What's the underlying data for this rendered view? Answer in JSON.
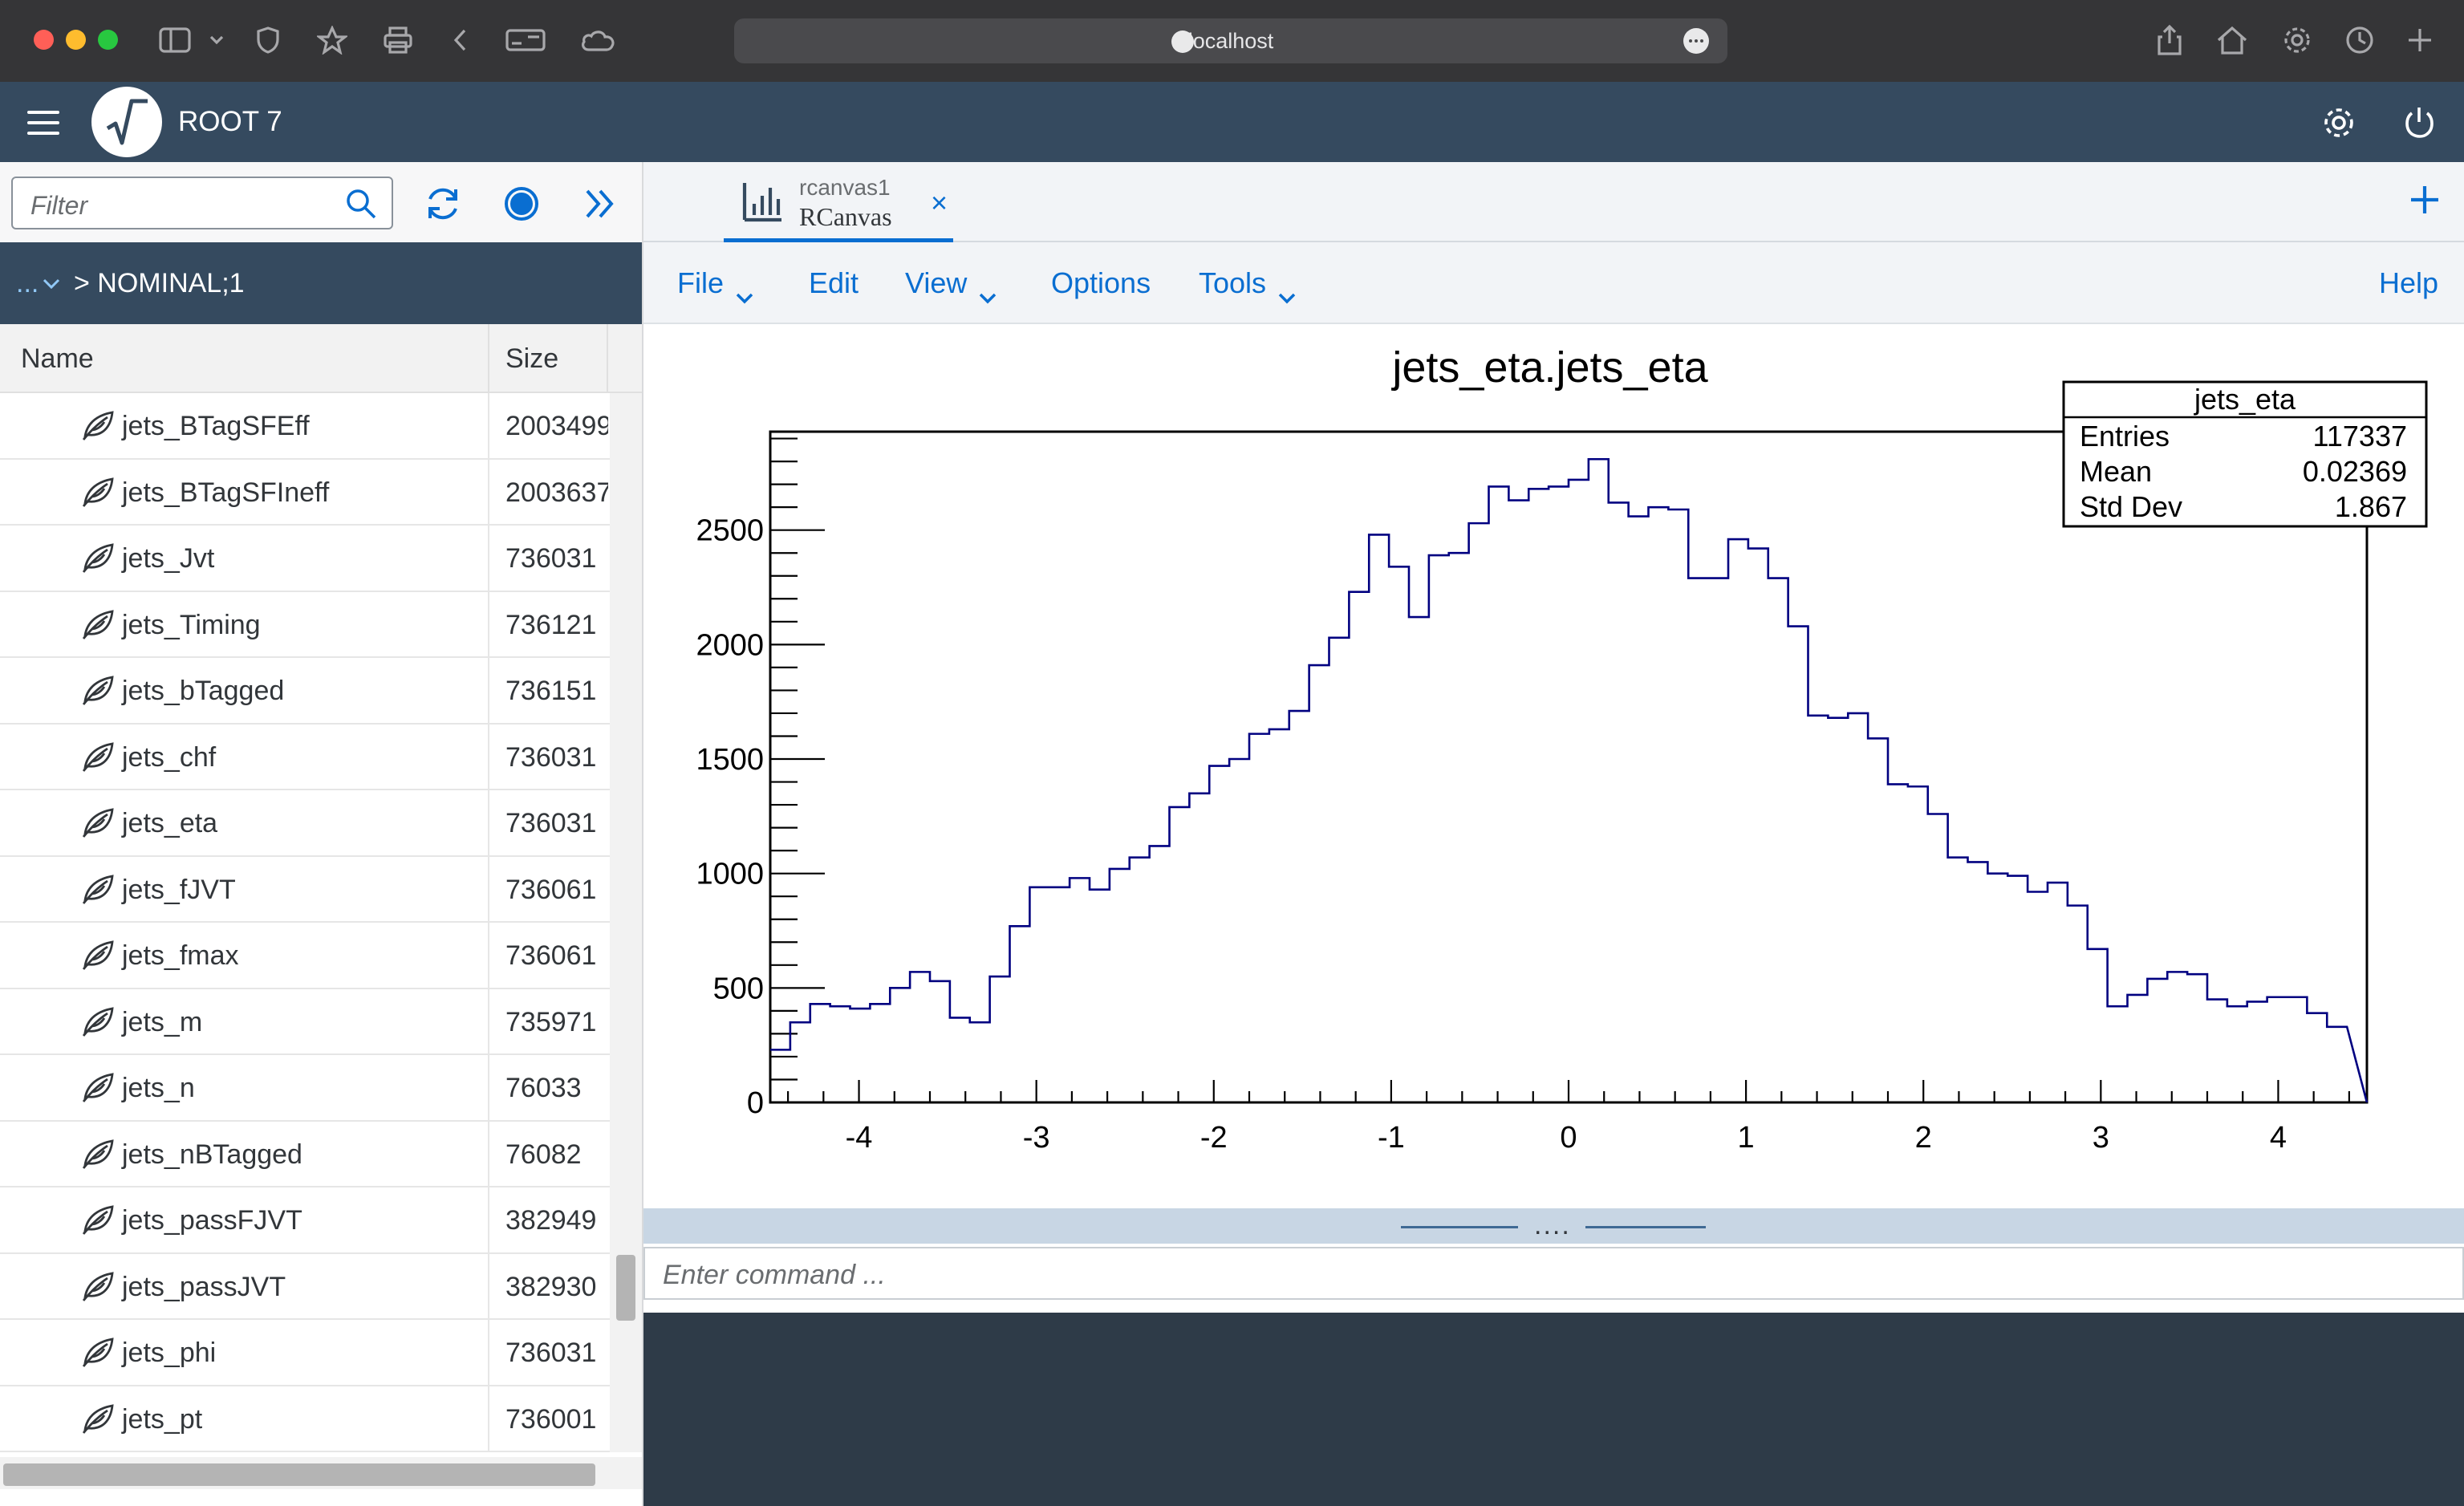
{
  "browser": {
    "url": "localhost"
  },
  "app": {
    "title": "ROOT 7"
  },
  "left_panel": {
    "filter_placeholder": "Filter",
    "breadcrumb_dots": "...",
    "breadcrumb_text": "> NOMINAL;1",
    "columns": {
      "name": "Name",
      "size": "Size"
    },
    "rows": [
      {
        "name": "jets_BTagSFEff",
        "size": "2003499"
      },
      {
        "name": "jets_BTagSFIneff",
        "size": "2003637"
      },
      {
        "name": "jets_Jvt",
        "size": "736031"
      },
      {
        "name": "jets_Timing",
        "size": "736121"
      },
      {
        "name": "jets_bTagged",
        "size": "736151"
      },
      {
        "name": "jets_chf",
        "size": "736031"
      },
      {
        "name": "jets_eta",
        "size": "736031"
      },
      {
        "name": "jets_fJVT",
        "size": "736061"
      },
      {
        "name": "jets_fmax",
        "size": "736061"
      },
      {
        "name": "jets_m",
        "size": "735971"
      },
      {
        "name": "jets_n",
        "size": "76033"
      },
      {
        "name": "jets_nBTagged",
        "size": "76082"
      },
      {
        "name": "jets_passFJVT",
        "size": "382949"
      },
      {
        "name": "jets_passJVT",
        "size": "382930"
      },
      {
        "name": "jets_phi",
        "size": "736031"
      },
      {
        "name": "jets_pt",
        "size": "736001"
      }
    ]
  },
  "tab": {
    "subtitle": "rcanvas1",
    "title": "RCanvas",
    "close": "×"
  },
  "menu": {
    "file": "File",
    "edit": "Edit",
    "view": "View",
    "options": "Options",
    "tools": "Tools",
    "help": "Help"
  },
  "command": {
    "placeholder": "Enter command ...",
    "splitter_dots": "...."
  },
  "colors": {
    "header": "#354a5f",
    "accent": "#0a6ed1",
    "histogram_line": "#000080"
  },
  "chart_data": {
    "type": "histogram",
    "title": "jets_eta.jets_eta",
    "xlim": [
      -4.5,
      4.5
    ],
    "ylim": [
      0,
      2930
    ],
    "x_ticks": [
      -4,
      -3,
      -2,
      -1,
      0,
      1,
      2,
      3,
      4
    ],
    "y_ticks": [
      0,
      500,
      1000,
      1500,
      2000,
      2500
    ],
    "bin_width": 0.1125,
    "values": [
      230,
      350,
      430,
      420,
      410,
      430,
      500,
      570,
      530,
      370,
      350,
      550,
      770,
      940,
      940,
      980,
      930,
      1020,
      1070,
      1120,
      1290,
      1350,
      1470,
      1500,
      1610,
      1630,
      1710,
      1910,
      2030,
      2230,
      2480,
      2340,
      2120,
      2390,
      2400,
      2530,
      2690,
      2630,
      2680,
      2690,
      2720,
      2810,
      2620,
      2560,
      2600,
      2590,
      2290,
      2290,
      2460,
      2420,
      2290,
      2080,
      1690,
      1680,
      1700,
      1590,
      1390,
      1380,
      1260,
      1070,
      1050,
      1000,
      990,
      920,
      960,
      860,
      670,
      420,
      470,
      540,
      570,
      560,
      450,
      420,
      440,
      460,
      460,
      390,
      330
    ],
    "stats": {
      "title": "jets_eta",
      "rows": [
        {
          "label": "Entries",
          "value": "117337"
        },
        {
          "label": "Mean",
          "value": "0.02369"
        },
        {
          "label": "Std Dev",
          "value": "1.867"
        }
      ]
    },
    "grid": false
  }
}
